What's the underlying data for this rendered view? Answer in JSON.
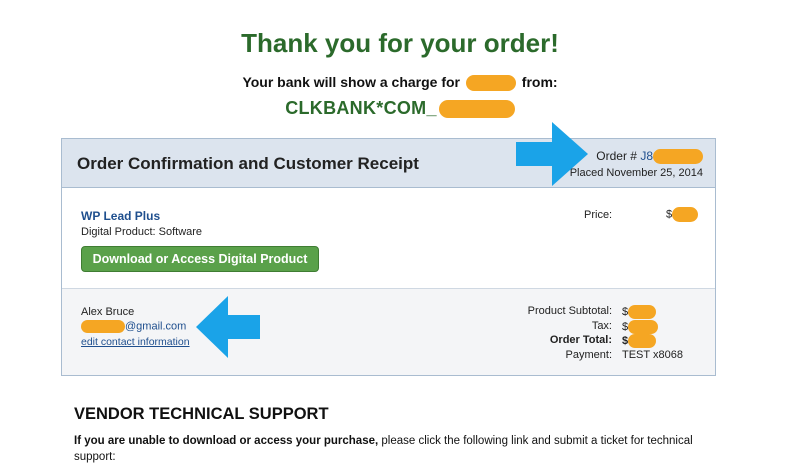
{
  "header": {
    "title": "Thank you for your order!",
    "bank_line": "Your bank will show a charge for",
    "bank_line_suffix": "from:",
    "descriptor": "CLKBANK*COM_"
  },
  "receipt": {
    "title": "Order Confirmation and Customer Receipt",
    "order_label": "Order #",
    "order_number_visible": "J8",
    "placed": "Placed November 25, 2014"
  },
  "product": {
    "name": "WP Lead Plus",
    "type": "Digital Product: Software",
    "download_button": "Download or Access Digital Product",
    "price_label": "Price:",
    "price_prefix": "$"
  },
  "customer": {
    "name": "Alex Bruce",
    "email_suffix": "@gmail.com",
    "edit_link": "edit contact information"
  },
  "totals": {
    "rows": [
      {
        "label": "Product Subtotal:",
        "value": "$",
        "bold": false
      },
      {
        "label": "Tax:",
        "value": "$",
        "bold": false
      },
      {
        "label": "Order Total:",
        "value": "$",
        "bold": true
      },
      {
        "label": "Payment:",
        "value": "TEST x8068",
        "bold": false
      }
    ]
  },
  "vendor": {
    "title": "VENDOR TECHNICAL SUPPORT",
    "text_bold": "If you are unable to download or access your purchase,",
    "text_rest": " please click the following link and submit a ticket for technical support:"
  },
  "colors": {
    "accent_green": "#2b6a2b",
    "button_green": "#5aa14a",
    "link_blue": "#1f4f8e",
    "header_bg": "#dce4ee",
    "redaction_orange": "#f5a623",
    "arrow_blue": "#1aa3e8"
  }
}
